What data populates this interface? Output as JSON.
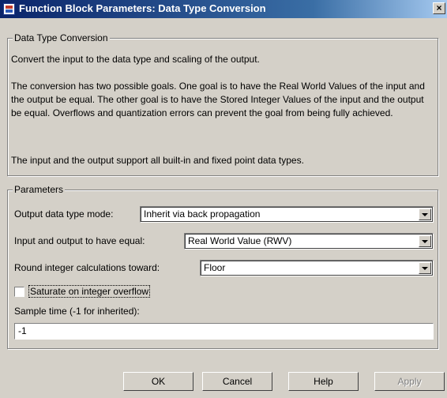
{
  "window": {
    "title": "Function Block Parameters: Data Type Conversion",
    "close_label": "×"
  },
  "block_group": {
    "legend": "Data Type Conversion",
    "description": [
      "Convert the input to the data type and scaling of the output.",
      "The conversion has two possible goals. One goal is to have the Real World Values of the input and the output be equal.  The other goal is to have the Stored Integer Values of the input and the output be equal.  Overflows and quantization errors can prevent the goal from being fully achieved.",
      "The input and the output support all built-in and fixed point data types."
    ]
  },
  "parameters": {
    "legend": "Parameters",
    "output_mode": {
      "label": "Output data type mode:",
      "value": "Inherit via back propagation"
    },
    "equal": {
      "label": "Input and output to have equal:",
      "value": "Real World Value (RWV)"
    },
    "round": {
      "label": "Round integer calculations toward:",
      "value": "Floor"
    },
    "saturate": {
      "label": "Saturate on integer overflow",
      "checked": false
    },
    "sample_time": {
      "label": "Sample time (-1 for inherited):",
      "value": "-1"
    }
  },
  "buttons": {
    "ok": "OK",
    "cancel": "Cancel",
    "help": "Help",
    "apply": "Apply"
  }
}
